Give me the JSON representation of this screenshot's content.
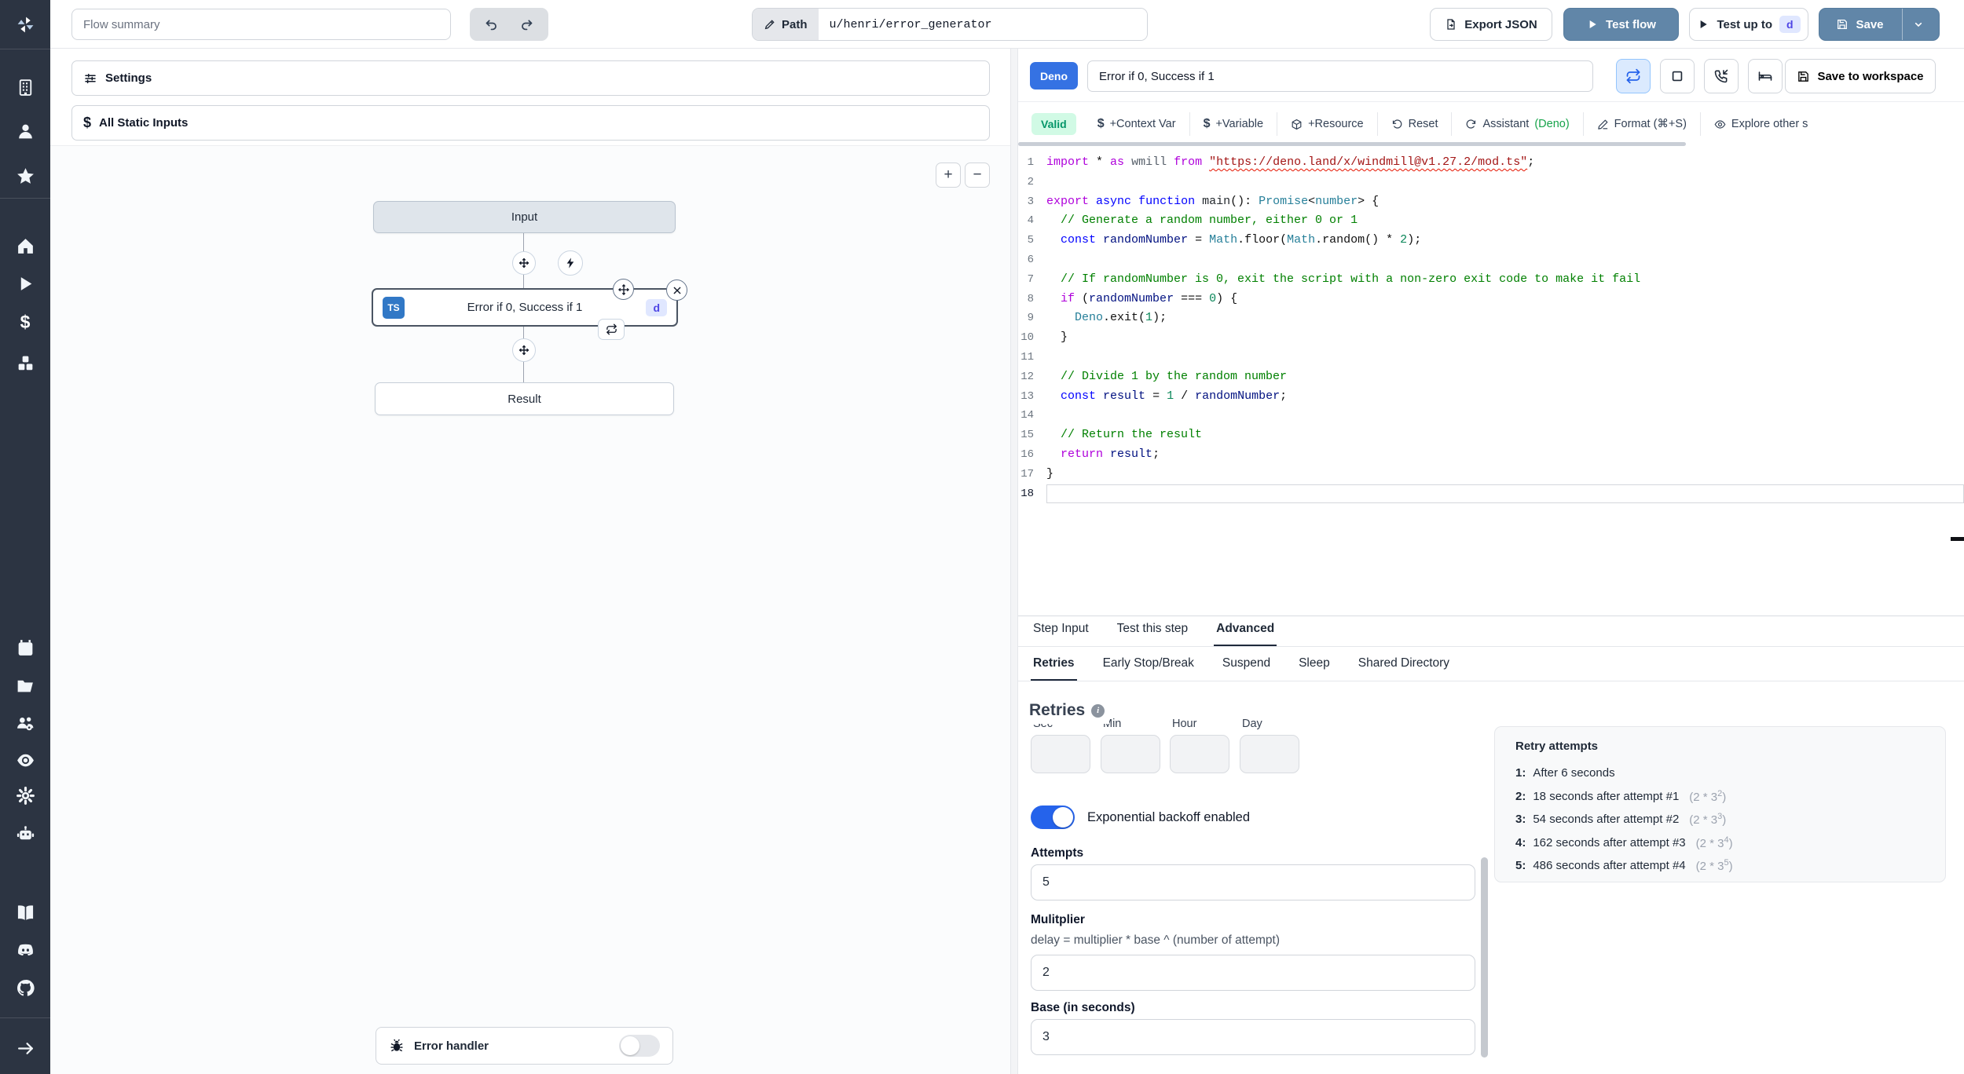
{
  "colors": {
    "primary_button": "#6186a8",
    "deno_badge": "#3572e3",
    "ts_badge": "#3178c6",
    "id_badge_bg": "#e0e7ff",
    "id_badge_text": "#4f46e5",
    "valid_bg": "#d1fae5",
    "valid_text": "#059669",
    "toggle_on": "#2563eb",
    "sidebar_bg": "#2c3442"
  },
  "topbar": {
    "flow_summary_placeholder": "Flow summary",
    "path_label": "Path",
    "path_value": "u/henri/error_generator",
    "export_json": "Export JSON",
    "test_flow": "Test flow",
    "test_up_to": "Test up to",
    "test_up_to_step": "d",
    "save": "Save"
  },
  "left_panel": {
    "settings": "Settings",
    "static_inputs": "All Static Inputs",
    "dollar_icon": "$",
    "zoom_in": "+",
    "zoom_out": "−",
    "canvas": {
      "input_node": "Input",
      "step_lang": "TS",
      "step_title": "Error if 0, Success if 1",
      "step_id": "d",
      "result_node": "Result",
      "error_handler": "Error handler"
    }
  },
  "step_editor": {
    "lang_badge": "Deno",
    "title": "Error if 0, Success if 1",
    "save_to_workspace": "Save to workspace",
    "toolbar": {
      "valid": "Valid",
      "context_var": "+Context Var",
      "variable": "+Variable",
      "resource": "+Resource",
      "reset": "Reset",
      "assistant": "Assistant",
      "assistant_lang": "(Deno)",
      "format": "Format (⌘+S)",
      "explore": "Explore other s",
      "dollar_glyph": "$"
    }
  },
  "code": {
    "active_line": 18,
    "lines": [
      {
        "n": 1,
        "t": [
          [
            "kc",
            "import"
          ],
          [
            "pl",
            " * "
          ],
          [
            "kc",
            "as"
          ],
          [
            "pl",
            " "
          ],
          [
            "ns",
            "wmill"
          ],
          [
            "pl",
            " "
          ],
          [
            "kc",
            "from"
          ],
          [
            "pl",
            " "
          ],
          [
            "str",
            "\"https://deno.land/x/windmill@v1.27.2/mod.ts\""
          ],
          [
            "pl",
            ";"
          ]
        ]
      },
      {
        "n": 2,
        "t": []
      },
      {
        "n": 3,
        "t": [
          [
            "kc",
            "export"
          ],
          [
            "pl",
            " "
          ],
          [
            "kb",
            "async"
          ],
          [
            "pl",
            " "
          ],
          [
            "kb",
            "function"
          ],
          [
            "pl",
            " "
          ],
          [
            "fn",
            "main"
          ],
          [
            "pl",
            "(): "
          ],
          [
            "ty",
            "Promise"
          ],
          [
            "pl",
            "<"
          ],
          [
            "ty",
            "number"
          ],
          [
            "pl",
            "> {"
          ]
        ]
      },
      {
        "n": 4,
        "t": [
          [
            "cm",
            "  // Generate a random number, either 0 or 1"
          ]
        ]
      },
      {
        "n": 5,
        "t": [
          [
            "pl",
            "  "
          ],
          [
            "kb",
            "const"
          ],
          [
            "pl",
            " "
          ],
          [
            "vr",
            "randomNumber"
          ],
          [
            "pl",
            " = "
          ],
          [
            "ty",
            "Math"
          ],
          [
            "pl",
            ".floor("
          ],
          [
            "ty",
            "Math"
          ],
          [
            "pl",
            ".random() * "
          ],
          [
            "nm",
            "2"
          ],
          [
            "pl",
            ");"
          ]
        ]
      },
      {
        "n": 6,
        "t": []
      },
      {
        "n": 7,
        "t": [
          [
            "cm",
            "  // If randomNumber is 0, exit the script with a non-zero exit code to make it fail"
          ]
        ]
      },
      {
        "n": 8,
        "t": [
          [
            "pl",
            "  "
          ],
          [
            "kc",
            "if"
          ],
          [
            "pl",
            " ("
          ],
          [
            "vr",
            "randomNumber"
          ],
          [
            "pl",
            " === "
          ],
          [
            "nm",
            "0"
          ],
          [
            "pl",
            ") {"
          ]
        ]
      },
      {
        "n": 9,
        "t": [
          [
            "pl",
            "    "
          ],
          [
            "ty",
            "Deno"
          ],
          [
            "pl",
            ".exit("
          ],
          [
            "nm",
            "1"
          ],
          [
            "pl",
            ");"
          ]
        ]
      },
      {
        "n": 10,
        "t": [
          [
            "pl",
            "  }"
          ]
        ]
      },
      {
        "n": 11,
        "t": []
      },
      {
        "n": 12,
        "t": [
          [
            "cm",
            "  // Divide 1 by the random number"
          ]
        ]
      },
      {
        "n": 13,
        "t": [
          [
            "pl",
            "  "
          ],
          [
            "kb",
            "const"
          ],
          [
            "pl",
            " "
          ],
          [
            "vr",
            "result"
          ],
          [
            "pl",
            " = "
          ],
          [
            "nm",
            "1"
          ],
          [
            "pl",
            " / "
          ],
          [
            "vr",
            "randomNumber"
          ],
          [
            "pl",
            ";"
          ]
        ]
      },
      {
        "n": 14,
        "t": []
      },
      {
        "n": 15,
        "t": [
          [
            "cm",
            "  // Return the result"
          ]
        ]
      },
      {
        "n": 16,
        "t": [
          [
            "pl",
            "  "
          ],
          [
            "kc",
            "return"
          ],
          [
            "pl",
            " "
          ],
          [
            "vr",
            "result"
          ],
          [
            "pl",
            ";"
          ]
        ]
      },
      {
        "n": 17,
        "t": [
          [
            "pl",
            "}"
          ]
        ]
      },
      {
        "n": 18,
        "t": []
      }
    ]
  },
  "tabs": {
    "step_input": "Step Input",
    "test_this_step": "Test this step",
    "advanced": "Advanced",
    "retries": "Retries",
    "early_stop": "Early Stop/Break",
    "suspend": "Suspend",
    "sleep": "Sleep",
    "shared_directory": "Shared Directory"
  },
  "retries": {
    "heading": "Retries",
    "sec": "Sec",
    "min": "Min",
    "hour": "Hour",
    "day": "Day",
    "backoff_label": "Exponential backoff enabled",
    "attempts_label": "Attempts",
    "attempts_value": "5",
    "multiplier_label": "Mulitplier",
    "multiplier_helper": "delay = multiplier * base ^ (number of attempt)",
    "multiplier_value": "2",
    "base_label": "Base (in seconds)",
    "base_value": "3",
    "panel_title": "Retry attempts",
    "items": [
      {
        "n": "1:",
        "text": "After 6 seconds",
        "fp": "",
        "fe": "",
        "fs": ""
      },
      {
        "n": "2:",
        "text": "18 seconds after attempt #1",
        "fp": "(2 * 3",
        "fe": "2",
        "fs": ")"
      },
      {
        "n": "3:",
        "text": "54 seconds after attempt #2",
        "fp": "(2 * 3",
        "fe": "3",
        "fs": ")"
      },
      {
        "n": "4:",
        "text": "162 seconds after attempt #3",
        "fp": "(2 * 3",
        "fe": "4",
        "fs": ")"
      },
      {
        "n": "5:",
        "text": "486 seconds after attempt #4",
        "fp": "(2 * 3",
        "fe": "5",
        "fs": ")"
      }
    ]
  }
}
